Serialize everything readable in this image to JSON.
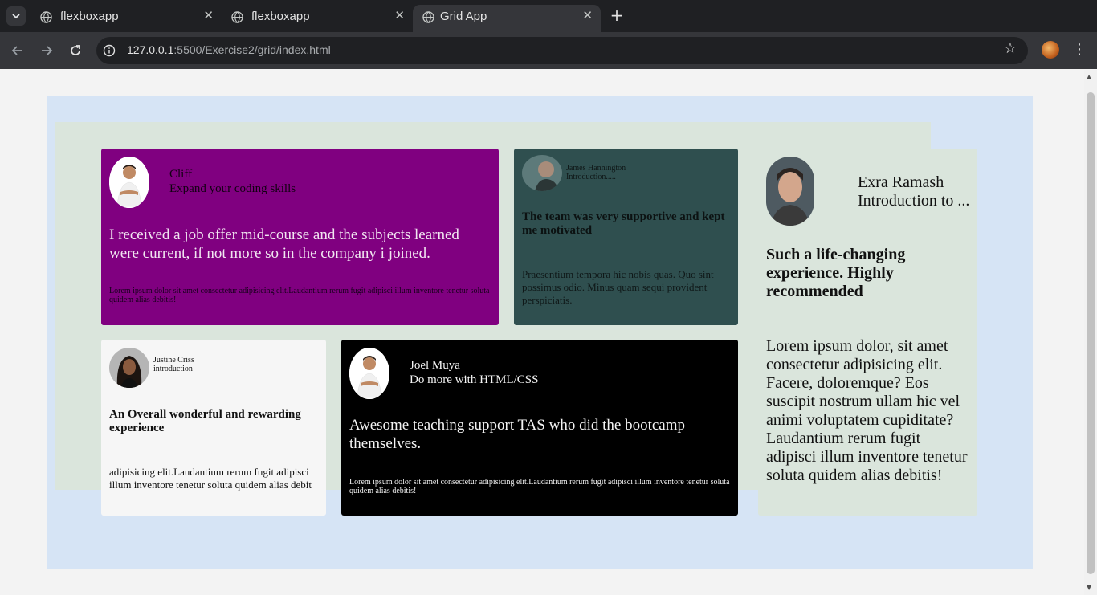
{
  "browser": {
    "tabs": [
      {
        "title": "flexboxapp",
        "active": false
      },
      {
        "title": "flexboxapp",
        "active": false
      },
      {
        "title": "Grid App",
        "active": true
      }
    ],
    "url_host": "127.0.0.1",
    "url_rest": ":5500/Exercise2/grid/index.html",
    "colors": {
      "tabstrip": "#1f2023",
      "toolbar": "#35363a"
    }
  },
  "page": {
    "colors": {
      "container": "#d6e4f5",
      "grid": "#dae5dc"
    },
    "cards": [
      {
        "name": "Cliff",
        "subtitle": "Expand your coding skills",
        "heading": "I received a job offer mid-course and the subjects learned were current, if not more so in the company i joined.",
        "body": "Lorem ipsum dolor sit amet consectetur adipisicing elit.Laudantium rerum fugit adipisci illum inventore tenetur soluta quidem alias debitis!",
        "background": "#800080"
      },
      {
        "name": "James Hannington",
        "subtitle": "Introduction.....",
        "heading": "The team was very supportive and kept me motivated",
        "body": "Praesentium tempora hic nobis quas. Quo sint possimus odio. Minus quam sequi provident perspiciatis.",
        "background": "#2f4f4f"
      },
      {
        "name": "Exra Ramash",
        "subtitle": "Introduction to ...",
        "heading": "Such a life-changing experience. Highly recommended",
        "body": "Lorem ipsum dolor, sit amet consectetur adipisicing elit. Facere, doloremque? Eos suscipit nostrum ullam hic vel animi voluptatem cupiditate? Laudantium rerum fugit adipisci illum inventore tenetur soluta quidem alias debitis!",
        "background": "#dae5dc"
      },
      {
        "name": "Justine Criss",
        "subtitle": "introduction",
        "heading": "An Overall wonderful and rewarding experience",
        "body": "adipisicing elit.Laudantium rerum fugit adipisci illum inventore tenetur soluta quidem alias debit",
        "background": "#f6f6f6"
      },
      {
        "name": "Joel Muya",
        "subtitle": "Do more with HTML/CSS",
        "heading": "Awesome teaching support TAS who did the bootcamp themselves.",
        "body": "Lorem ipsum dolor sit amet consectetur adipisicing elit.Laudantium rerum fugit adipisci illum inventore tenetur soluta quidem alias debitis!",
        "background": "#000000"
      }
    ]
  }
}
